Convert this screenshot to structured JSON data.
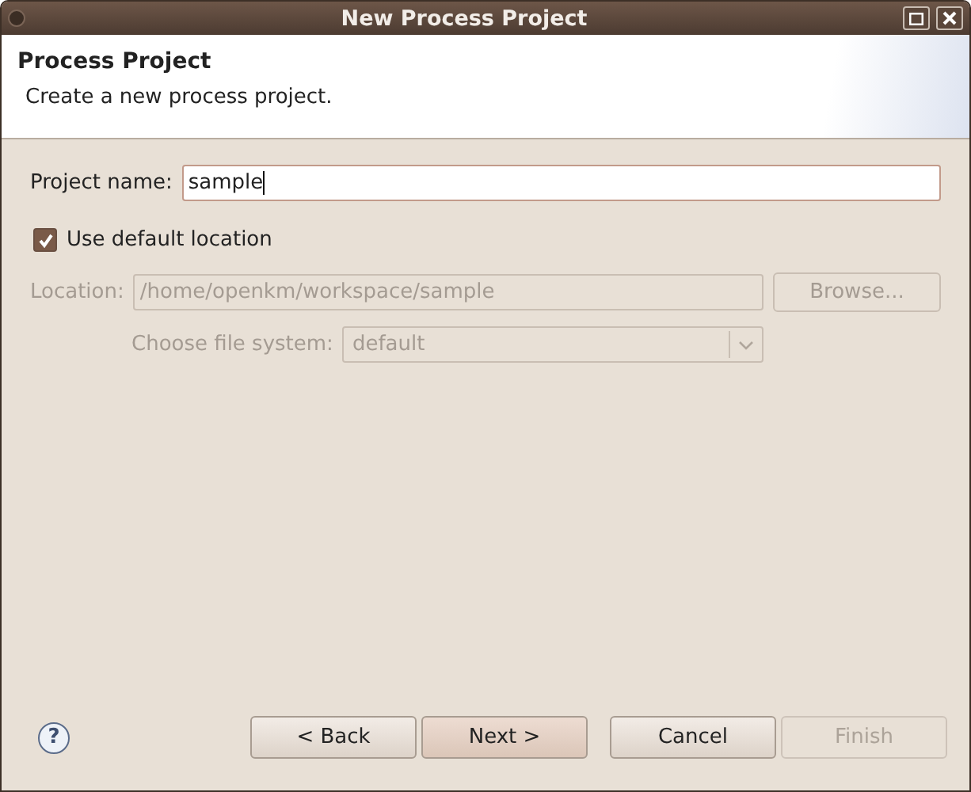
{
  "window": {
    "title": "New Process Project"
  },
  "header": {
    "title": "Process Project",
    "description": "Create a new process project."
  },
  "project_name": {
    "label": "Project name:",
    "value": "sample"
  },
  "use_default_location": {
    "label": "Use default location",
    "checked": true
  },
  "location": {
    "label": "Location:",
    "value": "/home/openkm/workspace/sample",
    "disabled": true,
    "browse": "Browse..."
  },
  "file_system": {
    "label": "Choose file system:",
    "value": "default",
    "disabled": true
  },
  "help": "?",
  "buttons": [
    {
      "label": "< Back",
      "disabled": false,
      "default": false
    },
    {
      "label": "Next >",
      "disabled": false,
      "default": true
    },
    {
      "label": "Cancel",
      "disabled": false,
      "default": false
    },
    {
      "label": "Finish",
      "disabled": true,
      "default": false
    }
  ]
}
